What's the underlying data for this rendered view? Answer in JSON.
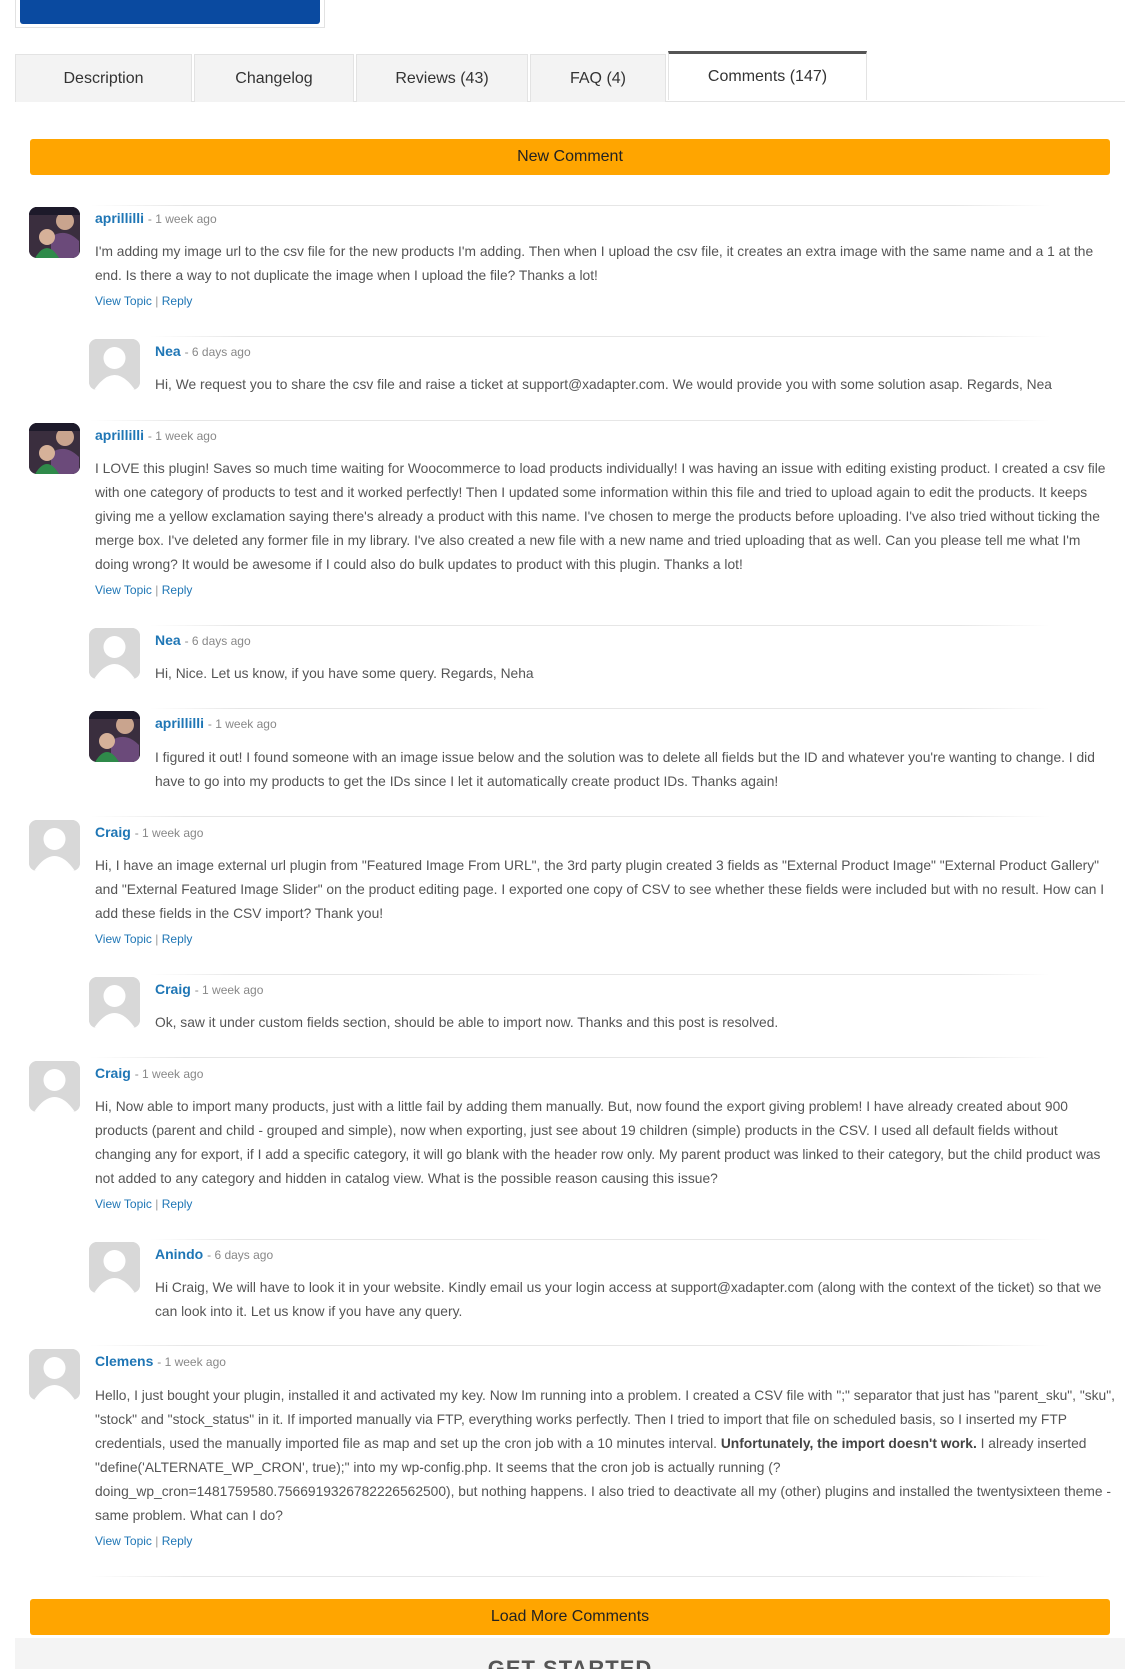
{
  "tabs": [
    {
      "label": "Description"
    },
    {
      "label": "Changelog"
    },
    {
      "label": "Reviews (43)"
    },
    {
      "label": "FAQ (4)"
    },
    {
      "label": "Comments (147)"
    }
  ],
  "new_comment_label": "New Comment",
  "load_more_label": "Load More Comments",
  "footer_heading": "GET STARTED",
  "link_view_topic": "View Topic",
  "link_reply": "Reply",
  "link_sep": "|",
  "comments": [
    {
      "author": "aprillilli",
      "time": "- 1 week ago",
      "text": "I'm adding my image url to the csv file for the new products I'm adding. Then when I upload the csv file, it creates an extra image with the same name and a 1 at the end. Is there a way to not duplicate the image when I upload the file? Thanks a lot!"
    },
    {
      "author": "Nea",
      "time": "- 6 days ago",
      "text": "Hi, We request you to share the csv file and raise a ticket at support@xadapter.com. We would provide you with some solution asap. Regards, Nea"
    },
    {
      "author": "aprillilli",
      "time": "- 1 week ago",
      "text": "I LOVE this plugin! Saves so much time waiting for Woocommerce to load products individually! I was having an issue with editing existing product. I created a csv file with one category of products to test and it worked perfectly! Then I updated some information within this file and tried to upload again to edit the products. It keeps giving me a yellow exclamation saying there's already a product with this name. I've chosen to merge the products before uploading. I've also tried without ticking the merge box. I've deleted any former file in my library. I've also created a new file with a new name and tried uploading that as well. Can you please tell me what I'm doing wrong? It would be awesome if I could also do bulk updates to product with this plugin. Thanks a lot!"
    },
    {
      "author": "Nea",
      "time": "- 6 days ago",
      "text": "Hi, Nice. Let us know, if you have some query. Regards, Neha"
    },
    {
      "author": "aprillilli",
      "time": "- 1 week ago",
      "text": "I figured it out! I found someone with an image issue below and the solution was to delete all fields but the ID and whatever you're wanting to change. I did have to go into my products to get the IDs since I let it automatically create product IDs. Thanks again!"
    },
    {
      "author": "Craig",
      "time": "- 1 week ago",
      "text": "Hi, I have an image external url plugin from \"Featured Image From URL\", the 3rd party plugin created 3 fields as \"External Product Image\" \"External Product Gallery\" and \"External Featured Image Slider\" on the product editing page. I exported one copy of CSV to see whether these fields were included but with no result. How can I add these fields in the CSV import? Thank you!"
    },
    {
      "author": "Craig",
      "time": "- 1 week ago",
      "text": "Ok, saw it under custom fields section, should be able to import now. Thanks and this post is resolved."
    },
    {
      "author": "Craig",
      "time": "- 1 week ago",
      "text": "Hi, Now able to import many products, just with a little fail by adding them manually. But, now found the export giving problem! I have already created about 900 products (parent and child - grouped and simple), now when exporting, just see about 19 children (simple) products in the CSV. I used all default fields without changing any for export, if I add a specific category, it will go blank with the header row only. My parent product was linked to their category, but the child product was not added to any category and hidden in catalog view. What is the possible reason causing this issue?"
    },
    {
      "author": "Anindo",
      "time": "- 6 days ago",
      "text": "Hi Craig, We will have to look it in your website. Kindly email us your login access at support@xadapter.com (along with the context of the ticket) so that we can look into it. Let us know if you have any query."
    },
    {
      "author": "Clemens",
      "time": "- 1 week ago",
      "text_a": "Hello, I just bought your plugin, installed it and activated my key. Now Im running into a problem. I created a CSV file with \";\" separator that just has \"parent_sku\", \"sku\", \"stock\" and \"stock_status\" in it. If imported manually via FTP, everything works perfectly. Then I tried to import that file on scheduled basis, so I inserted my FTP credentials, used the manually imported file as map and set up the cron job with a 10 minutes interval. ",
      "text_bold": "Unfortunately, the import doesn't work.",
      "text_b": " I already inserted \"define('ALTERNATE_WP_CRON', true);\" into my wp-config.php. It seems that the cron job is actually running (?doing_wp_cron=1481759580.7566919326782226562500), but nothing happens. I also tried to deactivate all my (other) plugins and installed the twentysixteen theme - same problem. What can I do?"
    }
  ]
}
